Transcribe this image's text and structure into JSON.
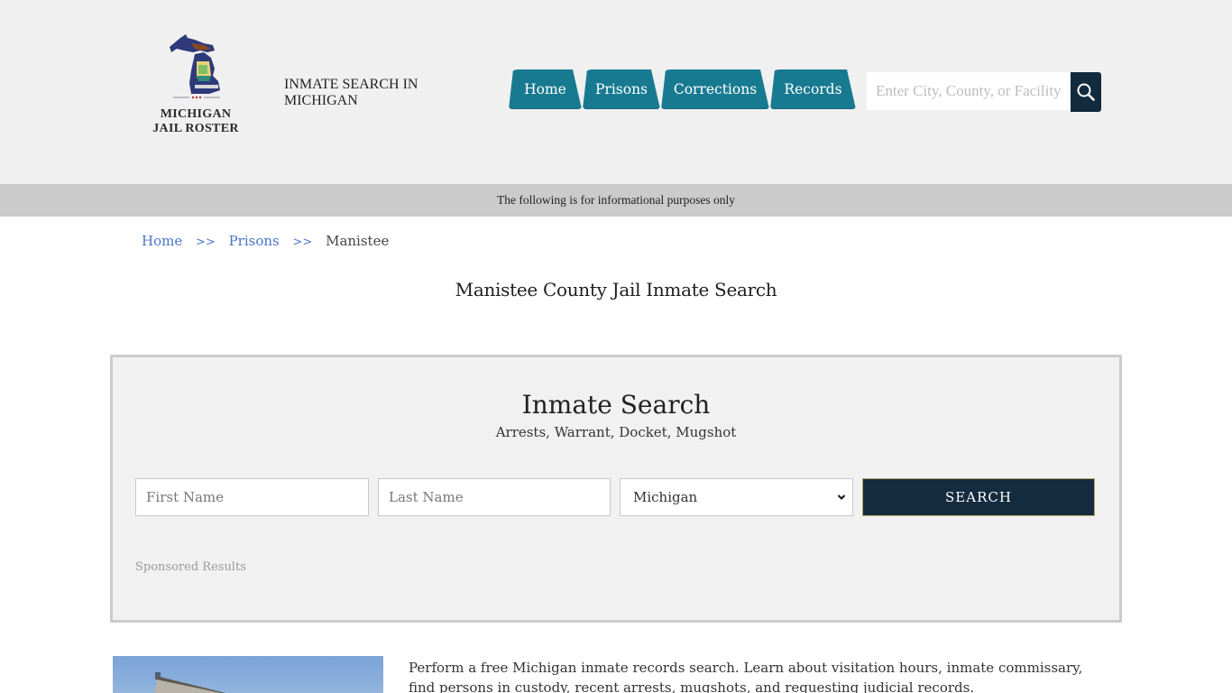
{
  "header": {
    "logo": {
      "icon": "michigan-state-map-icon",
      "line1": "MICHIGAN",
      "line2": "JAIL ROSTER"
    },
    "site_title": "INMATE SEARCH IN MICHIGAN",
    "nav": [
      {
        "label": "Home"
      },
      {
        "label": "Prisons"
      },
      {
        "label": "Corrections"
      },
      {
        "label": "Records"
      }
    ],
    "search": {
      "placeholder": "Enter City, County, or Facility",
      "value": "",
      "button_icon": "search-icon"
    },
    "accent_color": "#187a91",
    "dark_color": "#132b3e"
  },
  "notice": "The following is for informational purposes only",
  "breadcrumb": {
    "items": [
      {
        "label": "Home"
      },
      {
        "label": "Prisons"
      }
    ],
    "separator": ">>",
    "current": "Manistee"
  },
  "page_title": "Manistee County Jail Inmate Search",
  "inmate_search": {
    "title": "Inmate Search",
    "subtitle": "Arrests, Warrant, Docket, Mugshot",
    "first_name": {
      "placeholder": "First Name",
      "value": ""
    },
    "last_name": {
      "placeholder": "Last Name",
      "value": ""
    },
    "state": {
      "selected": "Michigan"
    },
    "submit_label": "SEARCH",
    "sponsored_label": "Sponsored Results"
  },
  "intro": {
    "image_alt": "Manistee County Jail building",
    "text": "Perform a free Michigan inmate records search. Learn about visitation hours, inmate commissary, find persons in custody, recent arrests, mugshots, and requesting judicial records."
  }
}
